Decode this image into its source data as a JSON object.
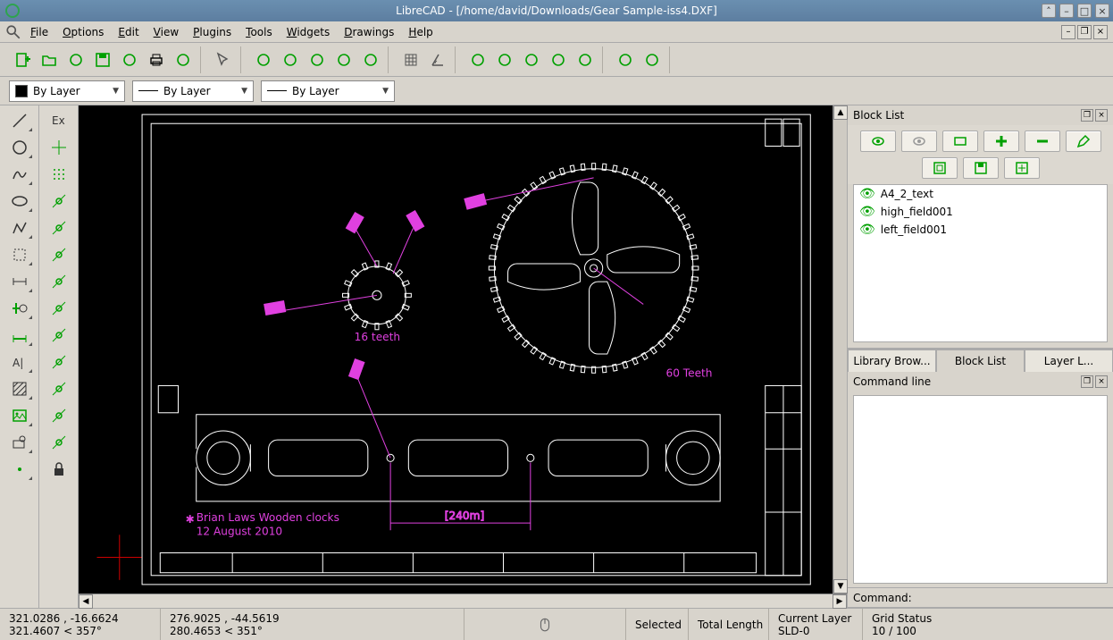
{
  "title": "LibreCAD - [/home/david/Downloads/Gear Sample-iss4.DXF]",
  "menu": [
    "File",
    "Options",
    "Edit",
    "View",
    "Plugins",
    "Tools",
    "Widgets",
    "Drawings",
    "Help"
  ],
  "propbar": {
    "color": "By Layer",
    "width": "By Layer",
    "linetype": "By Layer"
  },
  "blockList": {
    "title": "Block List",
    "items": [
      "A4_2_text",
      "high_field001",
      "left_field001"
    ]
  },
  "tabs": [
    "Library Brow...",
    "Block List",
    "Layer L..."
  ],
  "activeTab": 1,
  "commandLine": {
    "title": "Command line",
    "label": "Command:"
  },
  "status": {
    "absCoord": "321.0286 , -16.6624",
    "absPolar": "321.4607 < 357°",
    "relCoord": "276.9025 , -44.5619",
    "relPolar": "280.4653 < 351°",
    "selected": "Selected",
    "totalLength": "Total Length",
    "currentLayerLabel": "Current Layer",
    "currentLayerValue": "SLD-0",
    "gridLabel": "Grid Status",
    "gridValue": "10 / 100"
  },
  "drawing": {
    "smallGearLabel": "16 teeth",
    "largeGearLabel": "60 Teeth",
    "credit1": "Brian Laws Wooden clocks",
    "credit2": "12 August 2010"
  },
  "leftTools1": [
    "line",
    "circle",
    "curve",
    "ellipse",
    "polyline",
    "select",
    "dimension",
    "modify",
    "measure",
    "text",
    "hatch",
    "image",
    "block",
    "point"
  ],
  "leftTools2": [
    "exclusive",
    "snap-free",
    "snap-grid",
    "snap-endpoint",
    "snap-on-entity",
    "snap-center",
    "snap-middle",
    "snap-distance",
    "snap-intersection",
    "restrict-nothing",
    "restrict-horizontal",
    "restrict-vertical",
    "relative-zero",
    "lock"
  ],
  "toolbar": [
    [
      "new",
      "open",
      "recent",
      "save",
      "saveas",
      "print",
      "printpreview"
    ],
    [
      "pointer"
    ],
    [
      "zoom-window",
      "zoom-pan",
      "zoom-extents",
      "zoom-prev",
      "zoom-redraw"
    ],
    [
      "grid",
      "ortho"
    ],
    [
      "undo",
      "redo",
      "move",
      "break",
      "join"
    ],
    [
      "measure",
      "sync"
    ]
  ]
}
